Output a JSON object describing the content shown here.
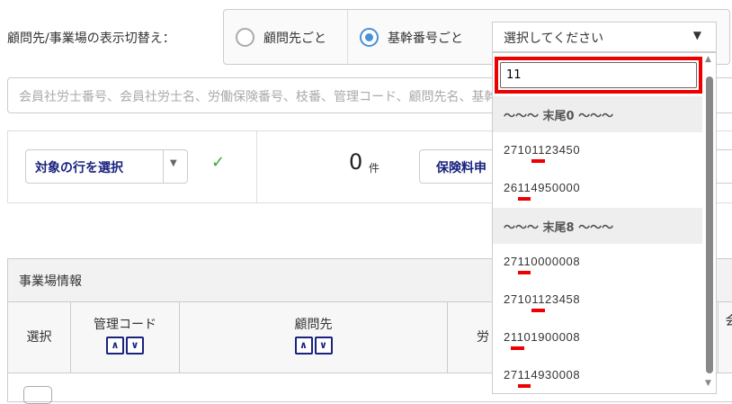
{
  "toggle": {
    "label": "顧問先/事業場の表示切替え：",
    "options": [
      {
        "label": "顧問先ごと",
        "selected": false
      },
      {
        "label": "基幹番号ごと",
        "selected": true
      }
    ],
    "select_value": "選択してください"
  },
  "search": {
    "placeholder": "会員社労士番号、会員社労士名、労働保険番号、枝番、管理コード、顧問先名、基幹番号"
  },
  "toolbar": {
    "select_rows": "対象の行を選択",
    "count": "0",
    "count_unit": "件",
    "premium_button": "保険料申"
  },
  "table": {
    "section": "事業場情報",
    "columns": [
      "選択",
      "管理コード",
      "顧問先",
      "労",
      "会"
    ],
    "sort_up": "∧",
    "sort_down": "∨"
  },
  "dropdown": {
    "query": "11",
    "groups": [
      {
        "label": "～～～ 末尾0 ～～～",
        "items": [
          "27101123450",
          "26114950000"
        ]
      },
      {
        "label": "～～～ 末尾8 ～～～",
        "items": [
          "27110000008",
          "27101123458",
          "21101900008",
          "27114930008"
        ]
      }
    ]
  },
  "colors": {
    "accent": "#1a237e",
    "highlight": "#ee0000",
    "radio": "#4a90d9"
  }
}
